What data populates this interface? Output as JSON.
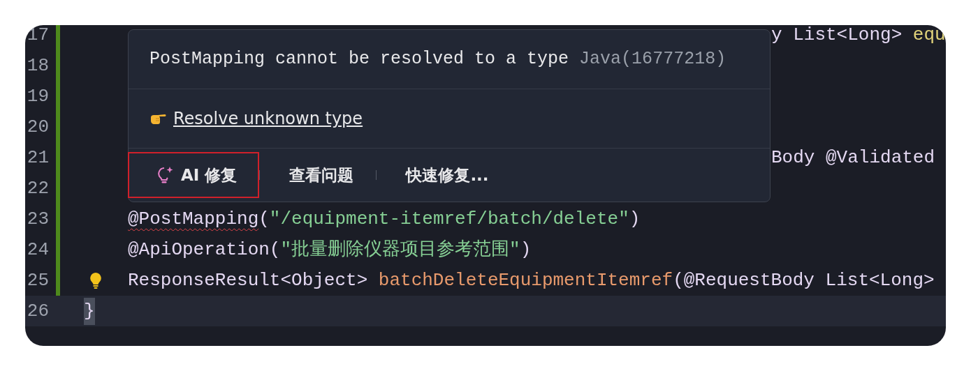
{
  "editor": {
    "lines": [
      {
        "number": "17",
        "modified": true,
        "covered": true,
        "tokens": [
          {
            "kind": "plain",
            "text": "y List<Long> "
          },
          {
            "kind": "param",
            "text": "equ"
          }
        ]
      },
      {
        "number": "18",
        "modified": true
      },
      {
        "number": "19",
        "modified": true
      },
      {
        "number": "20",
        "modified": true
      },
      {
        "number": "21",
        "modified": true,
        "covered": true,
        "tokens": [
          {
            "kind": "plain",
            "text": "Body @Validated"
          }
        ]
      },
      {
        "number": "22",
        "modified": true
      },
      {
        "number": "23",
        "modified": true,
        "indented": true,
        "tokens": [
          {
            "kind": "plain",
            "text": "@PostMapping",
            "error": true
          },
          {
            "kind": "plain",
            "text": "("
          },
          {
            "kind": "string",
            "text": "\"/equipment-itemref/batch/delete\""
          },
          {
            "kind": "plain",
            "text": ")"
          }
        ]
      },
      {
        "number": "24",
        "modified": true,
        "indented": true,
        "tokens": [
          {
            "kind": "plain",
            "text": "@ApiOperation("
          },
          {
            "kind": "string",
            "text": "\"批量删除仪器项目参考范围\""
          },
          {
            "kind": "plain",
            "text": ")"
          }
        ]
      },
      {
        "number": "25",
        "modified": true,
        "indented": true,
        "hint": true,
        "tokens": [
          {
            "kind": "plain",
            "text": "ResponseResult<Object> "
          },
          {
            "kind": "method",
            "text": "batchDeleteEquipmentItemref"
          },
          {
            "kind": "plain",
            "text": "(@RequestBody List<Long>"
          }
        ]
      },
      {
        "number": "26",
        "current": true,
        "tokens": [
          {
            "kind": "plain",
            "text": "}"
          }
        ]
      }
    ]
  },
  "popover": {
    "message": "PostMapping cannot be resolved to a type",
    "source": "Java(16777218)",
    "link": "Resolve unknown type",
    "actions": [
      {
        "label": "AI 修复",
        "kind": "ai",
        "outlined": true
      },
      {
        "label": "查看问题",
        "kind": "plain",
        "outlined": false
      },
      {
        "label": "快速修复...",
        "kind": "plain",
        "outlined": false
      }
    ]
  }
}
